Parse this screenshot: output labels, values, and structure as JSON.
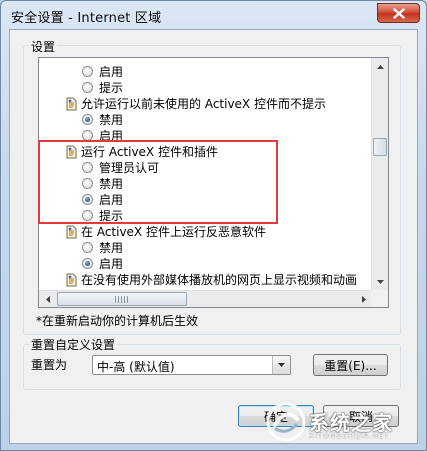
{
  "window": {
    "title": "安全设置 - Internet 区域"
  },
  "settings_group": {
    "label": "设置"
  },
  "list_items": [
    {
      "kind": "radio",
      "label": "启用",
      "checked": false
    },
    {
      "kind": "radio",
      "label": "提示",
      "checked": false
    },
    {
      "kind": "setting",
      "label": "允许运行以前未使用的 ActiveX 控件而不提示"
    },
    {
      "kind": "radio",
      "label": "禁用",
      "checked": true
    },
    {
      "kind": "radio",
      "label": "启用",
      "checked": false
    },
    {
      "kind": "setting",
      "label": "运行 ActiveX 控件和插件"
    },
    {
      "kind": "radio",
      "label": "管理员认可",
      "checked": false
    },
    {
      "kind": "radio",
      "label": "禁用",
      "checked": false
    },
    {
      "kind": "radio",
      "label": "启用",
      "checked": true
    },
    {
      "kind": "radio",
      "label": "提示",
      "checked": false
    },
    {
      "kind": "setting",
      "label": "在 ActiveX 控件上运行反恶意软件"
    },
    {
      "kind": "radio",
      "label": "禁用",
      "checked": false
    },
    {
      "kind": "radio",
      "label": "启用",
      "checked": true
    },
    {
      "kind": "setting",
      "label": "在没有使用外部媒体播放机的网页上显示视频和动画"
    },
    {
      "kind": "radio",
      "label": "禁用",
      "checked": false
    }
  ],
  "restart_note": "*在重新启动你的计算机后生效",
  "reset_group": {
    "label": "重置自定义设置",
    "reset_to_label": "重置为",
    "combo_value": "中-高 (默认值)",
    "reset_button": "重置(E)..."
  },
  "footer": {
    "ok_button": "确定",
    "cancel_button": "取消"
  },
  "watermark": {
    "text": "系统之家",
    "sub": "XITONGZHIJIA.NET"
  },
  "colors": {
    "highlight": "#e03a3a",
    "close": "#c2351f"
  }
}
